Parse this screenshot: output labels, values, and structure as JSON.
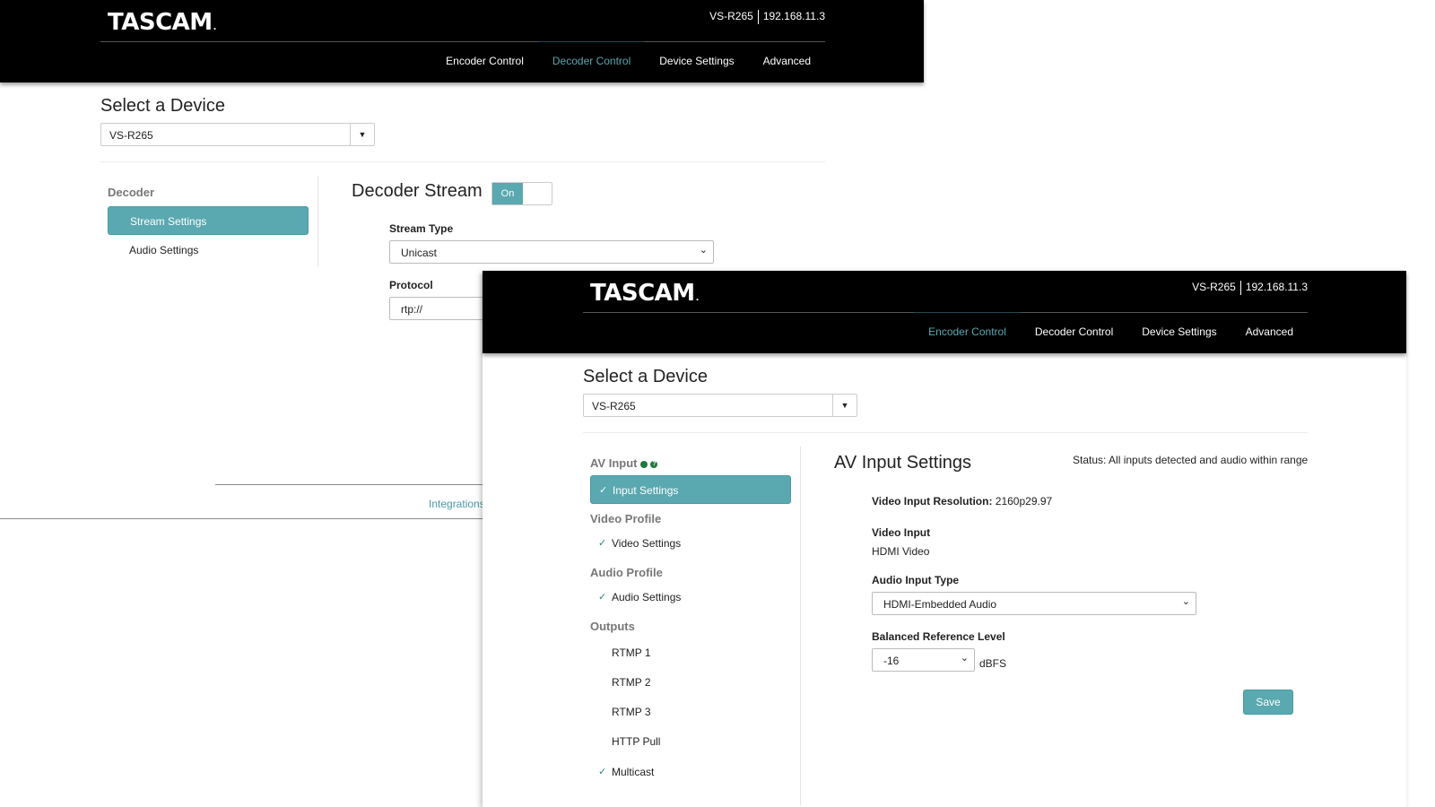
{
  "brand": "TASCAM",
  "brand_mark": ".",
  "accent_color": "#5aa8b0",
  "window1": {
    "device_name": "VS-R265",
    "device_ip": "192.168.11.3",
    "nav": [
      "Encoder Control",
      "Decoder Control",
      "Device Settings",
      "Advanced"
    ],
    "active_nav": "Decoder Control",
    "select_title": "Select a Device",
    "device_select_value": "VS-R265",
    "sidebar": {
      "heading": "Decoder",
      "items": [
        "Stream Settings",
        "Audio Settings"
      ]
    },
    "content": {
      "title": "Decoder Stream",
      "toggle_label": "On",
      "stream_type_label": "Stream Type",
      "stream_type_value": "Unicast",
      "protocol_label": "Protocol",
      "protocol_value": "rtp://"
    },
    "footer_link": "Integrations"
  },
  "window2": {
    "device_name": "VS-R265",
    "device_ip": "192.168.11.3",
    "nav": [
      "Encoder Control",
      "Decoder Control",
      "Device Settings",
      "Advanced"
    ],
    "active_nav": "Encoder Control",
    "select_title": "Select a Device",
    "device_select_value": "VS-R265",
    "sidebar": {
      "av_input_heading": "AV Input",
      "help_glyph": "?",
      "input_settings": "Input Settings",
      "video_profile_heading": "Video Profile",
      "video_settings": "Video Settings",
      "audio_profile_heading": "Audio Profile",
      "audio_settings": "Audio Settings",
      "outputs_heading": "Outputs",
      "outputs": [
        "RTMP 1",
        "RTMP 2",
        "RTMP 3",
        "HTTP Pull"
      ],
      "multicast": "Multicast",
      "check_glyph": "✓"
    },
    "content": {
      "title": "AV Input Settings",
      "status": "Status: All inputs detected and audio within range",
      "resolution_label": "Video Input Resolution:",
      "resolution_value": "2160p29.97",
      "video_input_label": "Video Input",
      "video_input_value": "HDMI Video",
      "audio_input_type_label": "Audio Input Type",
      "audio_input_type_value": "HDMI-Embedded Audio",
      "balanced_ref_label": "Balanced Reference Level",
      "balanced_ref_value": "-16",
      "balanced_ref_unit": "dBFS",
      "save": "Save"
    }
  }
}
